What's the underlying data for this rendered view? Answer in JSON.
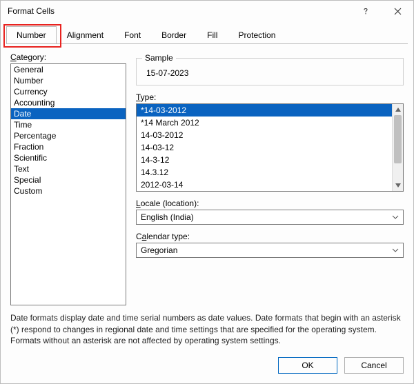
{
  "titlebar": {
    "title": "Format Cells"
  },
  "tabs": {
    "items": [
      {
        "label": "Number",
        "active": true
      },
      {
        "label": "Alignment",
        "active": false
      },
      {
        "label": "Font",
        "active": false
      },
      {
        "label": "Border",
        "active": false
      },
      {
        "label": "Fill",
        "active": false
      },
      {
        "label": "Protection",
        "active": false
      }
    ]
  },
  "category": {
    "label": "Category:",
    "items": [
      "General",
      "Number",
      "Currency",
      "Accounting",
      "Date",
      "Time",
      "Percentage",
      "Fraction",
      "Scientific",
      "Text",
      "Special",
      "Custom"
    ],
    "selected": "Date"
  },
  "sample": {
    "label": "Sample",
    "value": "15-07-2023"
  },
  "type": {
    "label": "Type:",
    "items": [
      "*14-03-2012",
      "*14 March 2012",
      "14-03-2012",
      "14-03-12",
      "14-3-12",
      "14.3.12",
      "2012-03-14"
    ],
    "selected": "*14-03-2012"
  },
  "locale": {
    "label": "Locale (location):",
    "value": "English (India)"
  },
  "calendar": {
    "label": "Calendar type:",
    "value": "Gregorian"
  },
  "description": "Date formats display date and time serial numbers as date values.  Date formats that begin with an asterisk (*) respond to changes in regional date and time settings that are specified for the operating system.  Formats without an asterisk are not affected by operating system settings.",
  "buttons": {
    "ok": "OK",
    "cancel": "Cancel"
  },
  "highlight": {
    "target": "tab-number"
  }
}
